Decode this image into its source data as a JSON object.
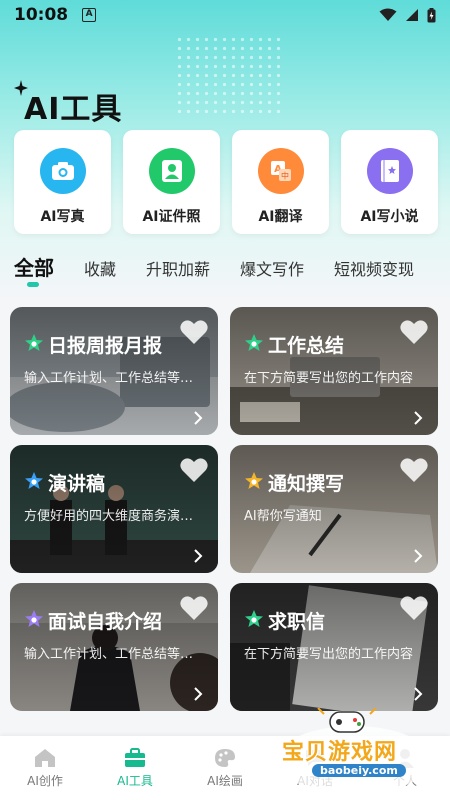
{
  "status": {
    "time": "10:08",
    "notification_letter": "A"
  },
  "page": {
    "title": "AI工具"
  },
  "tools": [
    {
      "label": "AI写真",
      "icon": "camera-icon",
      "color": "#27b6f0"
    },
    {
      "label": "AI证件照",
      "icon": "id-photo-icon",
      "color": "#22c96b"
    },
    {
      "label": "AI翻译",
      "icon": "translate-icon",
      "color": "#ff8a3a"
    },
    {
      "label": "AI写小说",
      "icon": "book-icon",
      "color": "#8a6ff0"
    }
  ],
  "tabs": [
    "全部",
    "收藏",
    "升职加薪",
    "爆文写作",
    "短视频变现"
  ],
  "cards": [
    {
      "title": "日报周报月报",
      "desc": "输入工作计划、工作总结等内容",
      "star_color": "#2fd18a"
    },
    {
      "title": "工作总结",
      "desc": "在下方简要写出您的工作内容",
      "star_color": "#2fd18a"
    },
    {
      "title": "演讲稿",
      "desc": "方便好用的四大维度商务演讲稿",
      "star_color": "#3aa0f5"
    },
    {
      "title": "通知撰写",
      "desc": "AI帮你写通知",
      "star_color": "#f5b52a"
    },
    {
      "title": "面试自我介绍",
      "desc": "输入工作计划、工作总结等内容",
      "star_color": "#9b7cf5"
    },
    {
      "title": "求职信",
      "desc": "在下方简要写出您的工作内容",
      "star_color": "#2fd18a"
    }
  ],
  "bottom_nav": [
    {
      "label": "AI创作",
      "icon": "home-icon"
    },
    {
      "label": "AI工具",
      "icon": "toolbox-icon",
      "active": true
    },
    {
      "label": "AI绘画",
      "icon": "palette-icon"
    },
    {
      "label": "AI对话",
      "icon": "chat-icon"
    },
    {
      "label": "个人",
      "icon": "person-icon"
    }
  ],
  "watermark": {
    "text": "宝贝游戏网",
    "url": "baobeiy.com"
  },
  "colors": {
    "accent": "#17b98f",
    "tab_indicator": "#21c7a8"
  }
}
